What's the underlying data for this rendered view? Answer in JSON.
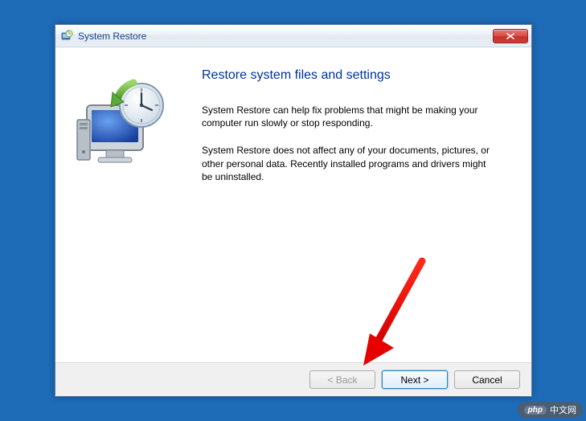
{
  "window": {
    "title": "System Restore"
  },
  "content": {
    "heading": "Restore system files and settings",
    "paragraph1": "System Restore can help fix problems that might be making your computer run slowly or stop responding.",
    "paragraph2": "System Restore does not affect any of your documents, pictures, or other personal data. Recently installed programs and drivers might be uninstalled."
  },
  "buttons": {
    "back": "< Back",
    "next": "Next >",
    "cancel": "Cancel"
  },
  "watermark": {
    "badge": "php",
    "text": "中文网"
  }
}
